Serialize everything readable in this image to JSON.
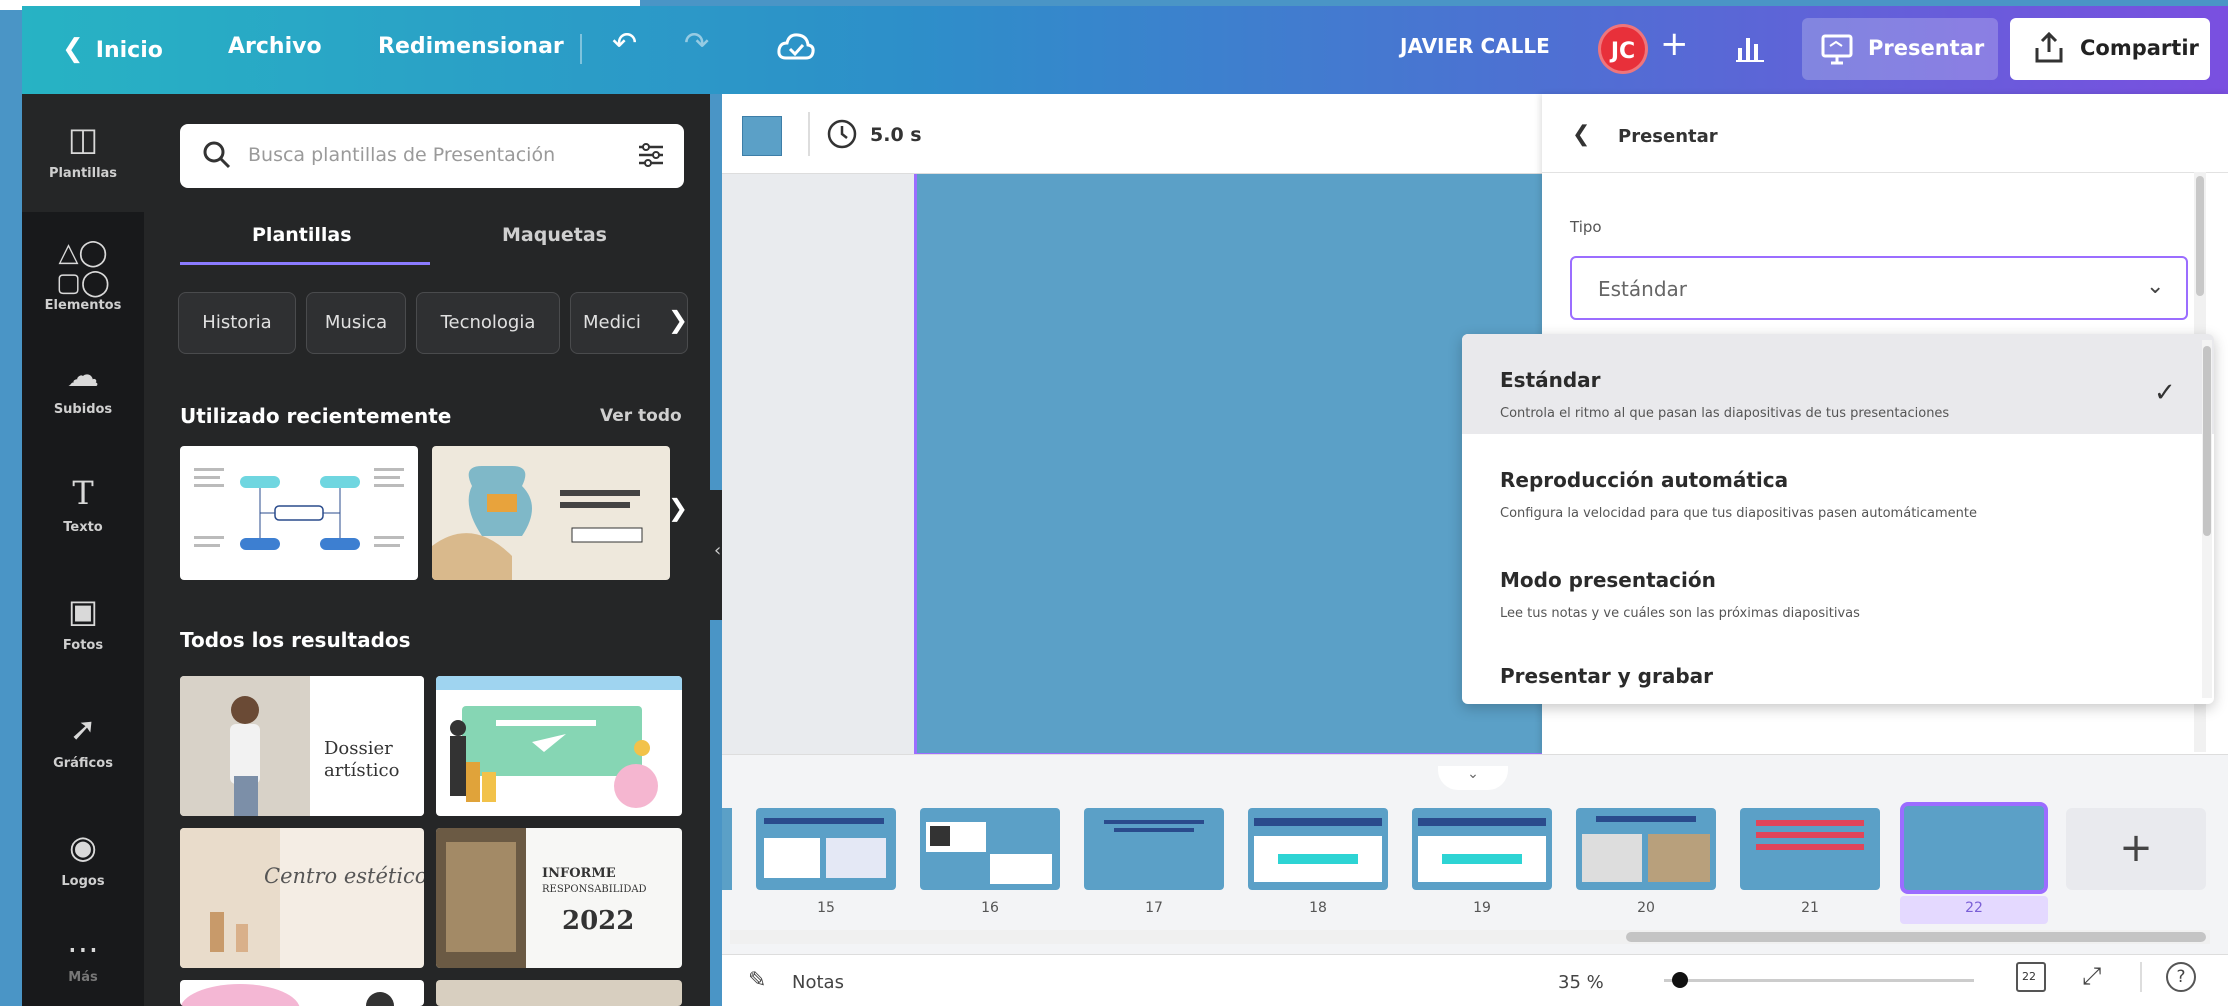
{
  "topbar": {
    "back_label": "Inicio",
    "file_label": "Archivo",
    "resize_label": "Redimensionar",
    "user_name": "JAVIER CALLE",
    "avatar_initials": "JC",
    "present_label": "Presentar",
    "share_label": "Compartir"
  },
  "rail": {
    "items": [
      {
        "label": "Plantillas",
        "icon": "templates-icon"
      },
      {
        "label": "Elementos",
        "icon": "elements-icon"
      },
      {
        "label": "Subidos",
        "icon": "upload-cloud-icon"
      },
      {
        "label": "Texto",
        "icon": "text-icon"
      },
      {
        "label": "Fotos",
        "icon": "photos-icon"
      },
      {
        "label": "Gráficos",
        "icon": "charts-icon"
      },
      {
        "label": "Logos",
        "icon": "logos-icon"
      },
      {
        "label": "Más",
        "icon": "more-icon"
      }
    ]
  },
  "panel": {
    "search_placeholder": "Busca plantillas de Presentación",
    "tabs": [
      "Plantillas",
      "Maquetas"
    ],
    "chips": [
      "Historia",
      "Musica",
      "Tecnologia",
      "Medici"
    ],
    "recent_heading": "Utilizado recientemente",
    "see_all": "Ver todo",
    "all_results_heading": "Todos los resultados",
    "result_texts": {
      "dossier_title": "Dossier",
      "dossier_sub": "artístico",
      "report_title": "INFORME",
      "report_sub": "RESPONSABILIDAD",
      "report_year": "2022",
      "script_title": "Centro estético"
    }
  },
  "toolbar": {
    "duration": "5.0 s",
    "swatch_color": "#5ba0c7"
  },
  "present_panel": {
    "title": "Presentar",
    "tipo_label": "Tipo",
    "tipo_value": "Estándar",
    "options": [
      {
        "title": "Estándar",
        "desc": "Controla el ritmo al que pasan las diapositivas de tus presentaciones",
        "selected": true
      },
      {
        "title": "Reproducción automática",
        "desc": "Configura la velocidad para que tus diapositivas pasen automáticamente",
        "selected": false
      },
      {
        "title": "Modo presentación",
        "desc": "Lee tus notas y ve cuáles son las próximas diapositivas",
        "selected": false
      },
      {
        "title": "Presentar y grabar",
        "desc": "",
        "selected": false
      }
    ]
  },
  "filmstrip": {
    "numbers": [
      "15",
      "16",
      "17",
      "18",
      "19",
      "20",
      "21",
      "22"
    ],
    "add_label": "+",
    "selected_slide": "22"
  },
  "bottombar": {
    "notes_label": "Notas",
    "zoom": "35 %",
    "zoom_level": 0.05,
    "page_indicator": "22"
  },
  "colors": {
    "accent": "#9b6dff",
    "slide_blue": "#5ba0c7",
    "avatar_red": "#e8303a"
  }
}
